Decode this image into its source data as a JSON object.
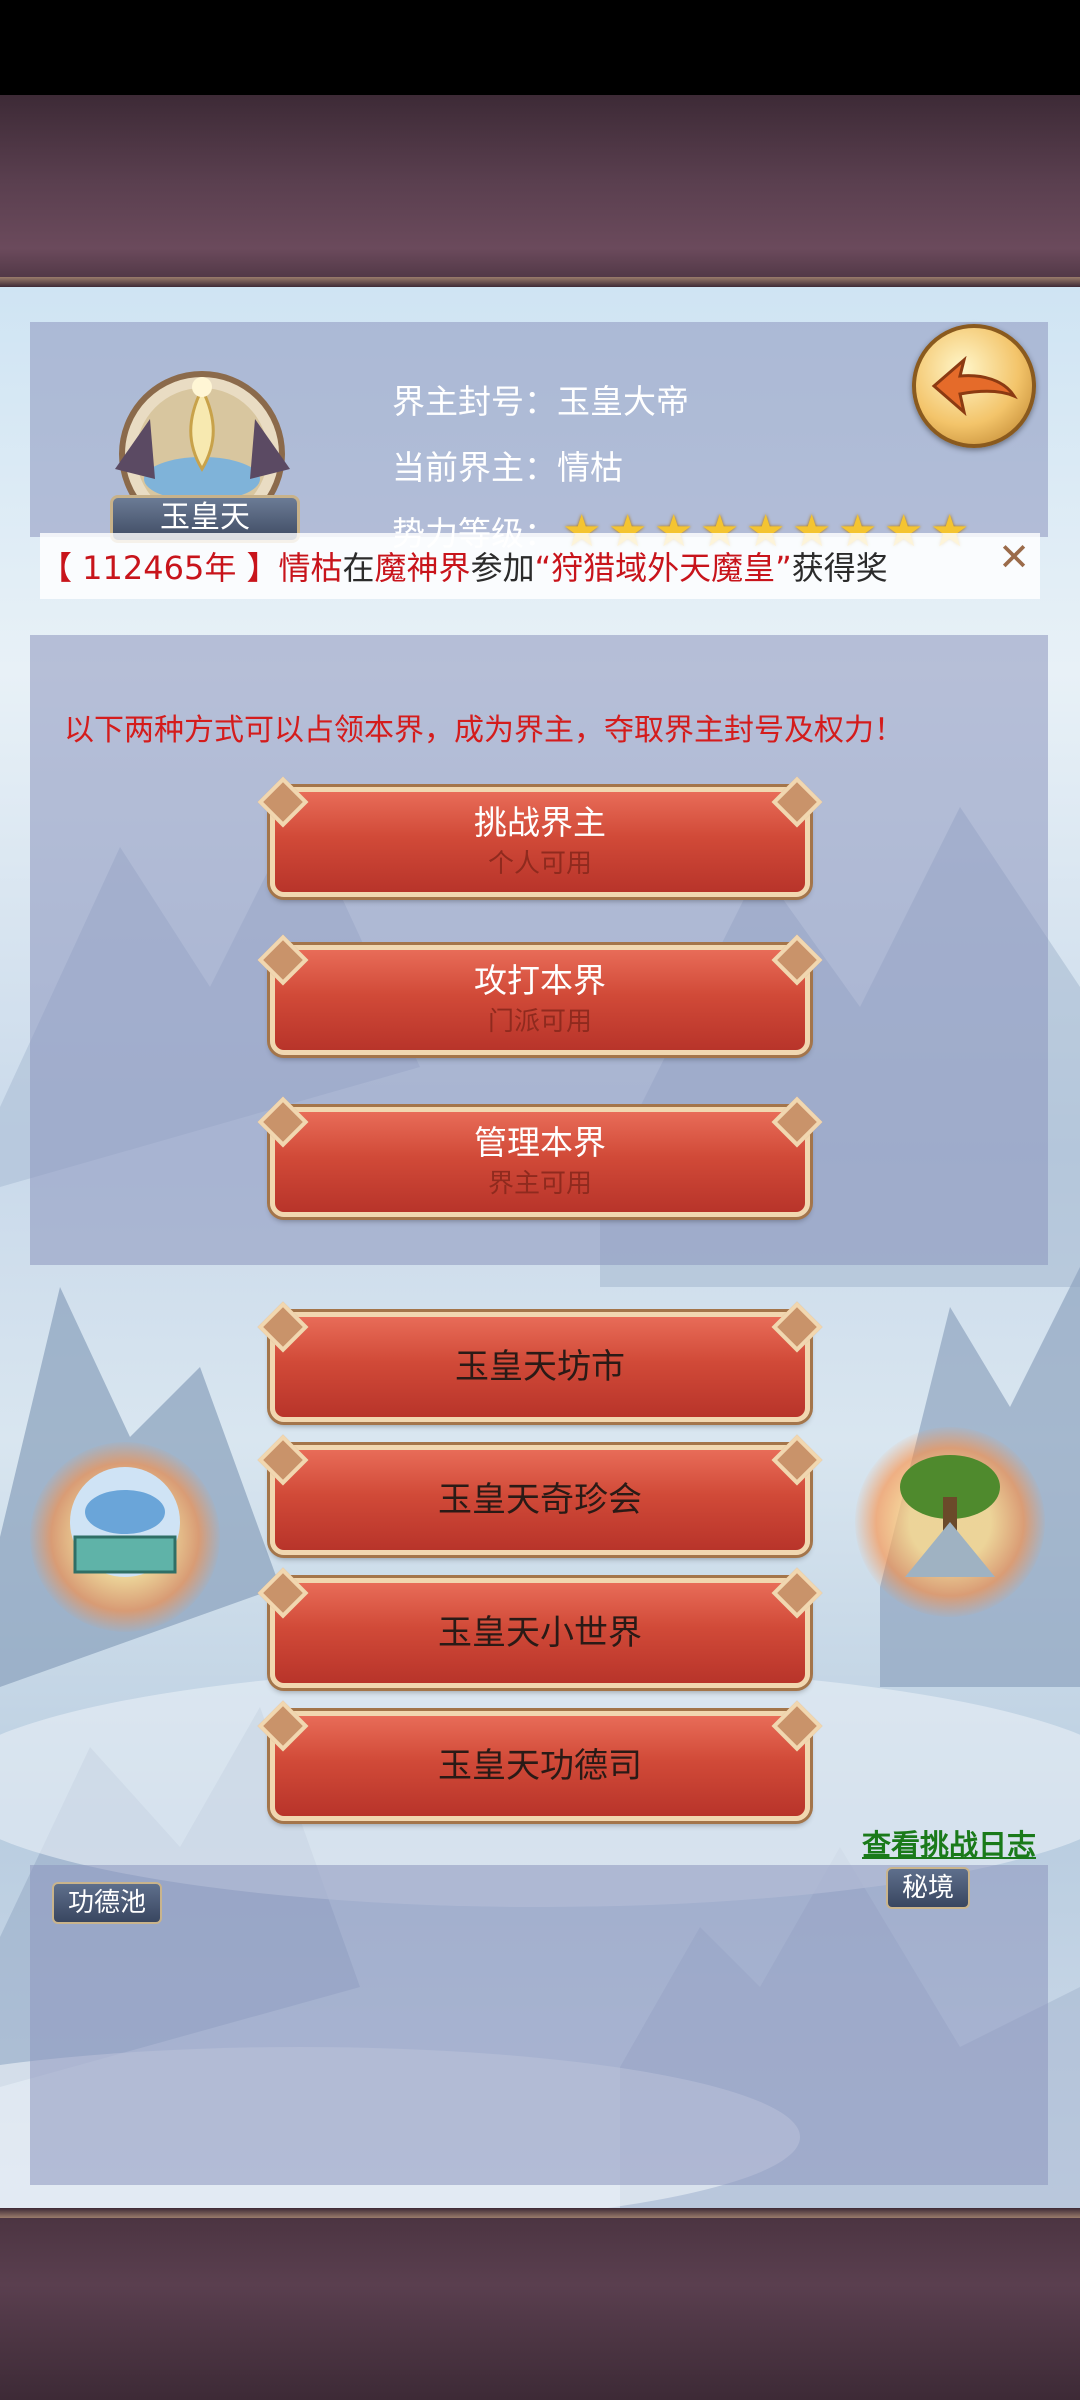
{
  "realm": {
    "emblem_name": "玉皇天",
    "title_line": "界主封号：玉皇大帝",
    "lord_line": "当前界主：情枯",
    "power_label": "势力等级：",
    "power_stars": 9,
    "back_icon": "back-arrow-icon"
  },
  "marquee": {
    "year": "【 112465年 】",
    "who": "情枯",
    "in": "在",
    "place": "魔神界",
    "join": "参加",
    "event": "“狩猎域外天魔皇”",
    "result": "获得奖",
    "close_icon": "close-x-icon"
  },
  "notice": "以下两种方式可以占领本界，成为界主，夺取界主封号及权力！",
  "actions": [
    {
      "label": "挑战界主",
      "sub": "个人可用"
    },
    {
      "label": "攻打本界",
      "sub": "门派可用"
    },
    {
      "label": "管理本界",
      "sub": "界主可用"
    }
  ],
  "menu": [
    {
      "label": "玉皇天坊市"
    },
    {
      "label": "玉皇天奇珍会"
    },
    {
      "label": "玉皇天小世界"
    },
    {
      "label": "玉皇天功德司"
    }
  ],
  "side": {
    "left_label": "功德池",
    "right_label": "秘境"
  },
  "log_link": "查看挑战日志",
  "colors": {
    "notice_red": "#d41c1c",
    "button_red": "#d14a38",
    "link_green": "#1a7a1a",
    "star_gold": "#f4c431"
  }
}
